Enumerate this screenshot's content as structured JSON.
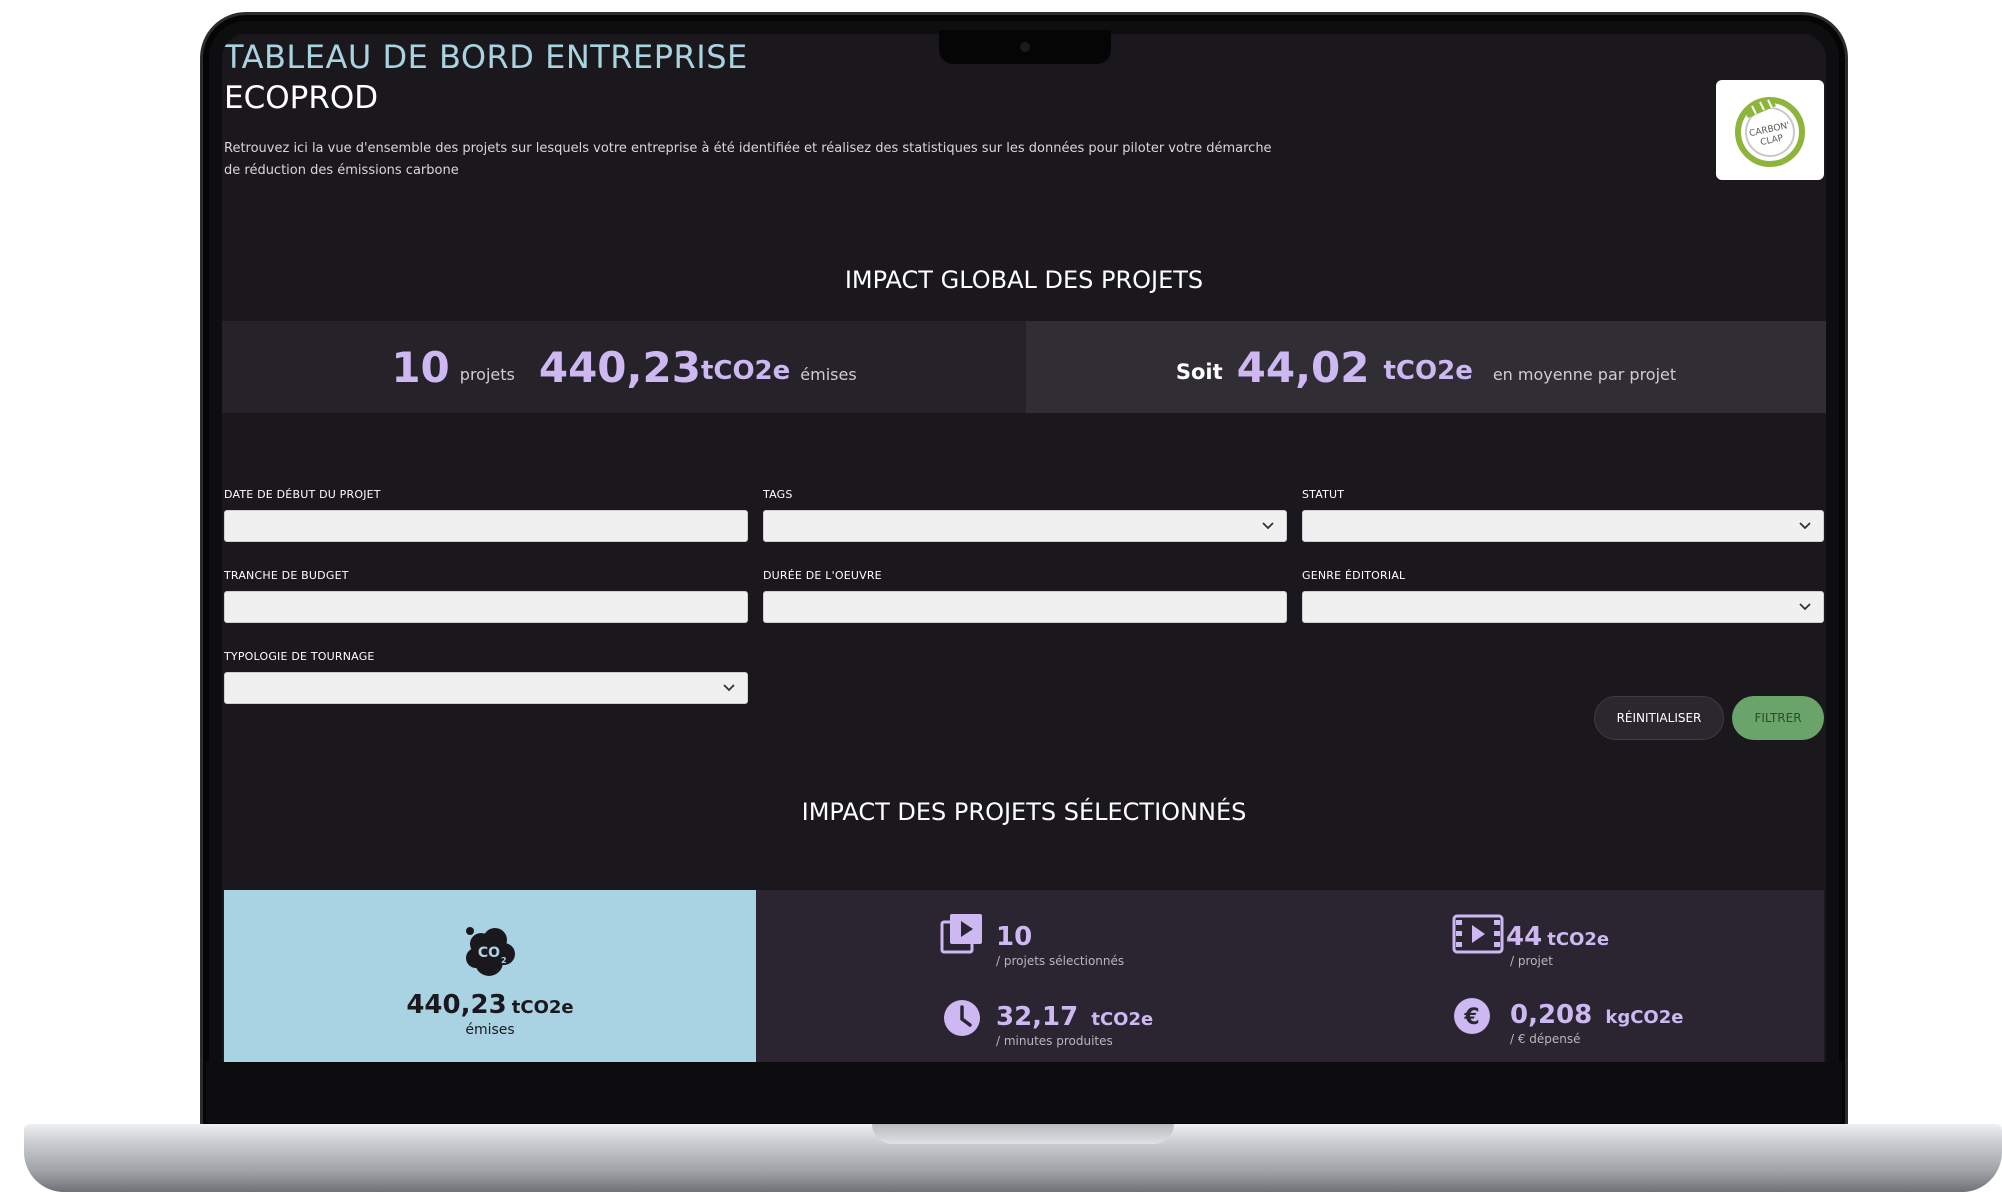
{
  "header": {
    "title": "TABLEAU DE BORD ENTREPRISE",
    "company": "ECOPROD",
    "intro": "Retrouvez ici la vue d'ensemble des projets sur lesquels votre entreprise à été identifiée et réalisez des statistiques sur les données pour piloter votre démarche de réduction des émissions carbone",
    "logo_text": "CARBON' CLAP"
  },
  "global": {
    "section_title": "IMPACT GLOBAL DES PROJETS",
    "projects_count": "10",
    "projects_label": "projets",
    "emissions_value": "440,23",
    "emissions_unit": "tCO2e",
    "emissions_label": "émises",
    "soit_label": "Soit",
    "avg_value": "44,02",
    "avg_unit": "tCO2e",
    "avg_label": "en moyenne par projet"
  },
  "filters": {
    "start_date_label": "DATE DE DÉBUT DU PROJET",
    "tags_label": "TAGS",
    "status_label": "STATUT",
    "budget_label": "TRANCHE DE BUDGET",
    "duration_label": "DURÉE DE L'OEUVRE",
    "genre_label": "GENRE ÉDITORIAL",
    "shooting_label": "TYPOLOGIE DE TOURNAGE",
    "reset_label": "RÉINITIALISER",
    "filter_label": "FILTRER"
  },
  "selected": {
    "section_title": "IMPACT DES PROJETS SÉLECTIONNÉS",
    "emis_value": "440,23",
    "emis_unit": "tCO2e",
    "emis_label": "émises",
    "projects_value": "10",
    "projects_sub": "/ projets sélectionnés",
    "per_project_value": "44",
    "per_project_unit": "tCO2e",
    "per_project_sub": "/ projet",
    "per_minute_value": "32,17",
    "per_minute_unit": "tCO2e",
    "per_minute_sub": "/ minutes produites",
    "per_euro_value": "0,208",
    "per_euro_unit": "kgCO2e",
    "per_euro_sub": "/ € dépensé"
  },
  "colors": {
    "title_blue": "#a8d3e1",
    "accent_purple": "#cdb8f2",
    "card_blue": "#a9d3e3",
    "filter_green": "#6aa46a",
    "bg": "#1b181d"
  }
}
